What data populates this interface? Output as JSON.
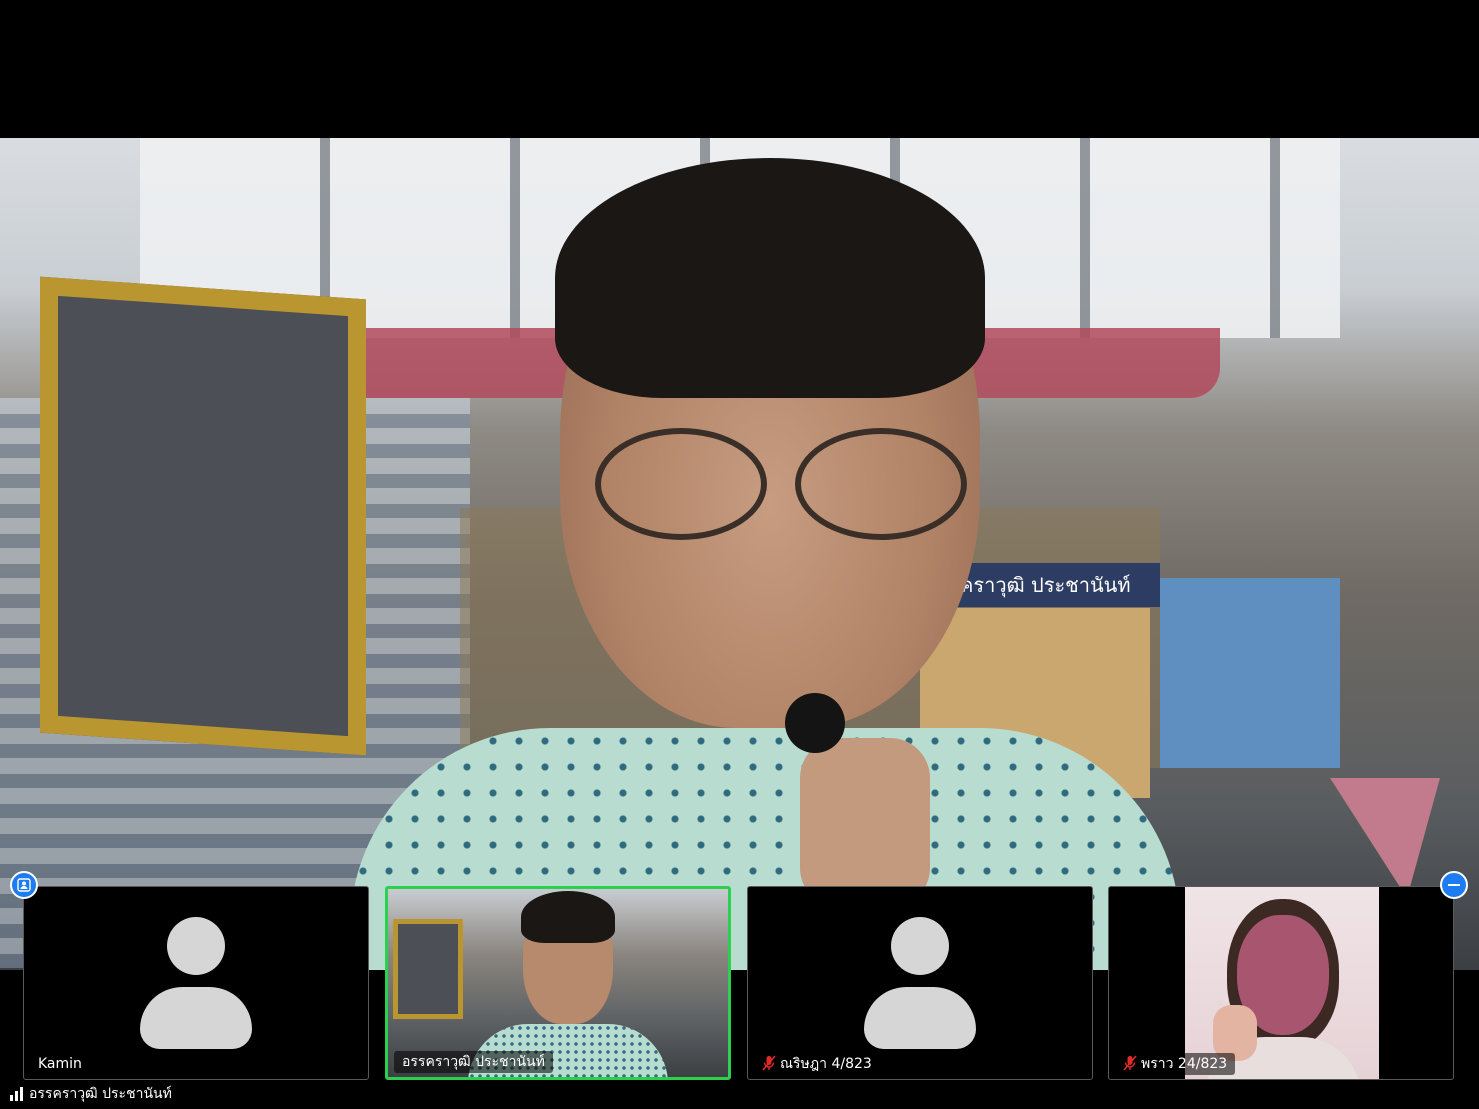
{
  "main_video": {
    "speaker": "อรรคราวุฒิ ประชานันท์",
    "banner_text": "คราวุฒิ ประชานันท์"
  },
  "participants": [
    {
      "name": "Kamin",
      "video": "off",
      "muted": false
    },
    {
      "name": "อรรคราวุฒิ ประชานันท์",
      "video": "on",
      "muted": false,
      "active_speaker": true
    },
    {
      "name": "ณริษฎา 4/823",
      "video": "off",
      "muted": true
    },
    {
      "name": "พราว 24/823",
      "video": "on",
      "muted": true
    }
  ],
  "status": {
    "current_user": "อรรคราวุฒิ ประชานันท์",
    "icon": "signal-bars-icon"
  },
  "colors": {
    "active_border": "#2bd14c",
    "badge": "#1d7cf2",
    "mute": "#e02a2a"
  }
}
